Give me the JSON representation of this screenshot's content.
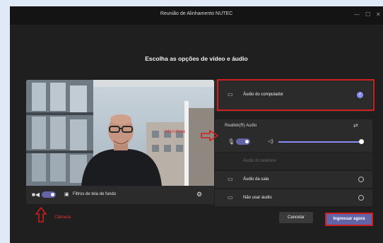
{
  "window": {
    "title": "Reunião de Alinhamento NUTEC",
    "minimize_glyph": "—",
    "maximize_glyph": "☐",
    "close_glyph": "✕"
  },
  "heading": "Escolha as opções de vídeo e áudio",
  "video_controls": {
    "camera_icon": "video-camera-icon",
    "camera_on": true,
    "background_filters_label": "Filtros de tela de fundo",
    "settings_icon": "gear-icon"
  },
  "audio": {
    "computer_audio": {
      "label": "Áudio do computador",
      "selected": true,
      "icon": "monitor-speaker-icon"
    },
    "device_label": "Realtek(R) Audio",
    "mic_on": true,
    "speaker_volume": 0.97,
    "phone_audio": {
      "label": "Áudio do telefone",
      "enabled": false
    },
    "room_audio": {
      "label": "Áudio da sala",
      "selected": false
    },
    "no_audio": {
      "label": "Não usar áudio",
      "selected": false
    }
  },
  "buttons": {
    "cancel": "Cancelar",
    "join": "Ingressar agora"
  },
  "annotations": {
    "microphone": "Microfone",
    "camera": "Câmera"
  },
  "colors": {
    "accent": "#6264a7",
    "annotation_red": "#d01f1f",
    "background": "#1f1f1f"
  }
}
